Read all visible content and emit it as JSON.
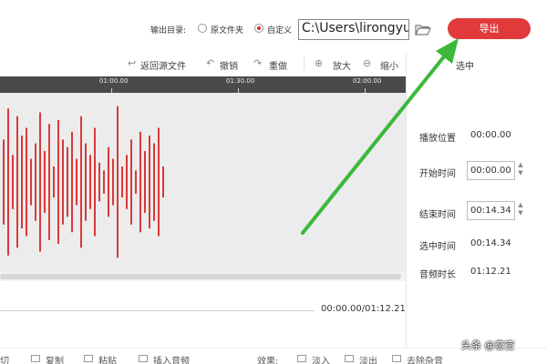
{
  "output": {
    "label": "输出目录:",
    "options": [
      {
        "label": "原文件夹",
        "checked": false
      },
      {
        "label": "自定义",
        "checked": true
      }
    ],
    "path": "C:\\Users\\lirongyu\\[",
    "export_label": "导出"
  },
  "toolbar": {
    "back_label": "返回源文件",
    "undo_label": "撤销",
    "redo_label": "重做",
    "zoom_in_label": "放大",
    "zoom_out_label": "缩小"
  },
  "side_title": "选中",
  "ruler": {
    "ticks": [
      "01:00.00",
      "01:30.00",
      "02:00.00"
    ]
  },
  "waveform": {
    "color": "#d93a3a",
    "amplitudes": [
      0.55,
      0.95,
      0.35,
      0.85,
      0.6,
      0.7,
      0.3,
      0.5,
      0.9,
      0.4,
      0.75,
      0.2,
      0.8,
      0.55,
      0.45,
      0.65,
      0.3,
      0.85,
      0.5,
      0.35,
      0.7,
      0.25,
      0.15,
      0.45,
      0.3,
      0.98,
      0.2,
      0.35,
      0.55,
      0.15,
      0.65,
      0.4,
      0.6,
      0.5,
      0.7,
      0.2
    ]
  },
  "time_readout": "00:00.00/01:12.21",
  "properties": {
    "play_position_label": "播放位置",
    "play_position_value": "00:00.00",
    "start_label": "开始时间",
    "start_value": "00:00.00",
    "end_label": "结束时间",
    "end_value": "00:14.34",
    "selected_label": "选中时间",
    "selected_value": "00:14.34",
    "duration_label": "音频时长",
    "duration_value": "01:12.21"
  },
  "bottom": {
    "items": [
      "切",
      "复制",
      "粘贴",
      "插入音频",
      "效果:",
      "淡入",
      "淡出",
      "去除杂音"
    ]
  },
  "watermark": "头条 @恋空",
  "colors": {
    "accent": "#e03a3a",
    "arrow": "#3cb83c"
  }
}
